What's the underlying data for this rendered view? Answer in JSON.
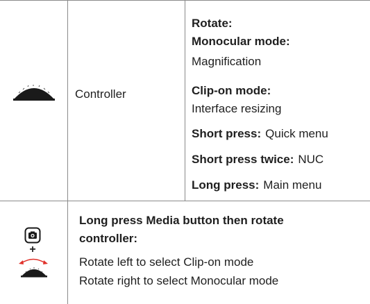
{
  "row1": {
    "label": "Controller",
    "rotate_title": "Rotate:",
    "monocular_title": "Monocular mode:",
    "monocular_desc": "Magnification",
    "clipon_title": "Clip-on mode:",
    "clipon_desc": "Interface resizing",
    "short_press_title": "Short press:",
    "short_press_desc": "Quick menu",
    "short_twice_title": "Short press twice:",
    "short_twice_desc": "NUC",
    "long_press_title": "Long press:",
    "long_press_desc": "Main menu"
  },
  "row2": {
    "title_line1": "Long press Media button then rotate",
    "title_line2": "controller:",
    "line1": "Rotate left to select Clip-on mode",
    "line2": "Rotate right to select Monocular mode",
    "plus": "+"
  },
  "colors": {
    "rule": "#8a8a8a",
    "icon_dark": "#1a1a1a",
    "arrow": "#e0312a"
  }
}
